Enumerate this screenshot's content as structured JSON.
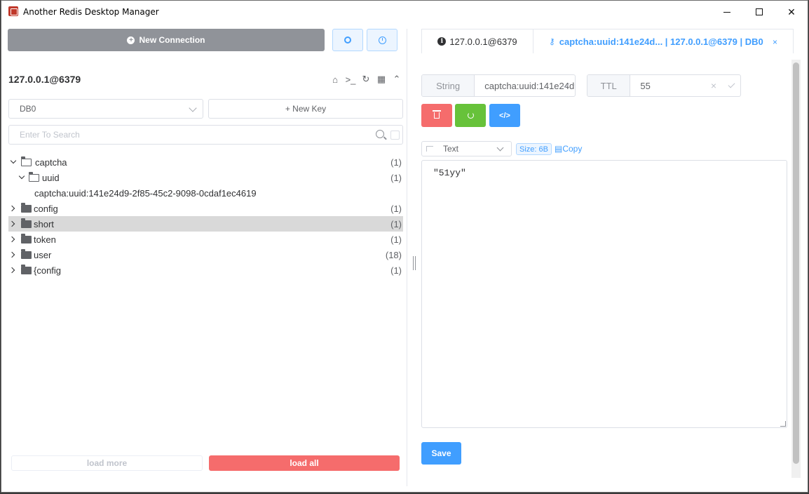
{
  "window": {
    "title": "Another Redis Desktop Manager",
    "controls": {
      "minimize": "",
      "maximize": "",
      "close": "✕"
    }
  },
  "left": {
    "new_connection_label": "New Connection",
    "connection_name": "127.0.0.1@6379",
    "db_value": "DB0",
    "new_key_label": "+ New Key",
    "search_placeholder": "Enter To Search",
    "conn_icons": [
      "home-icon",
      "terminal-icon",
      "refresh-icon",
      "grid-icon",
      "collapse-icon"
    ],
    "tree": [
      {
        "label": "captcha",
        "count": "(1)",
        "level": 0,
        "expanded": true,
        "type": "folder"
      },
      {
        "label": "uuid",
        "count": "(1)",
        "level": 1,
        "expanded": true,
        "type": "folder"
      },
      {
        "label": "captcha:uuid:141e24d9-2f85-45c2-9098-0cdaf1ec4619",
        "count": "",
        "level": 2,
        "type": "key"
      },
      {
        "label": "config",
        "count": "(1)",
        "level": 0,
        "expanded": false,
        "type": "folder"
      },
      {
        "label": "short",
        "count": "(1)",
        "level": 0,
        "expanded": false,
        "type": "folder",
        "selected": true
      },
      {
        "label": "token",
        "count": "(1)",
        "level": 0,
        "expanded": false,
        "type": "folder"
      },
      {
        "label": "user",
        "count": "(18)",
        "level": 0,
        "expanded": false,
        "type": "folder"
      },
      {
        "label": "{config",
        "count": "(1)",
        "level": 0,
        "expanded": false,
        "type": "folder"
      }
    ],
    "load_more_label": "load more",
    "load_all_label": "load all"
  },
  "tabs": [
    {
      "label": "127.0.0.1@6379",
      "icon": "info-icon",
      "active": false
    },
    {
      "label": "captcha:uuid:141e24d... | 127.0.0.1@6379 | DB0",
      "icon": "key-icon",
      "active": true,
      "close": "×"
    }
  ],
  "key_detail": {
    "type_label": "String",
    "key_name": "captcha:uuid:141e24d9-2f85-45c2-9098-0cdaf1ec4619",
    "ttl_label": "TTL",
    "ttl_value": "55",
    "format_value": "Text",
    "size_tag": "Size: 6B",
    "copy_label": "Copy",
    "value_text": "\"51yy\"",
    "save_label": "Save"
  },
  "colors": {
    "primary": "#409eff",
    "danger": "#f56c6c",
    "success": "#67c23a",
    "info": "#909399"
  }
}
